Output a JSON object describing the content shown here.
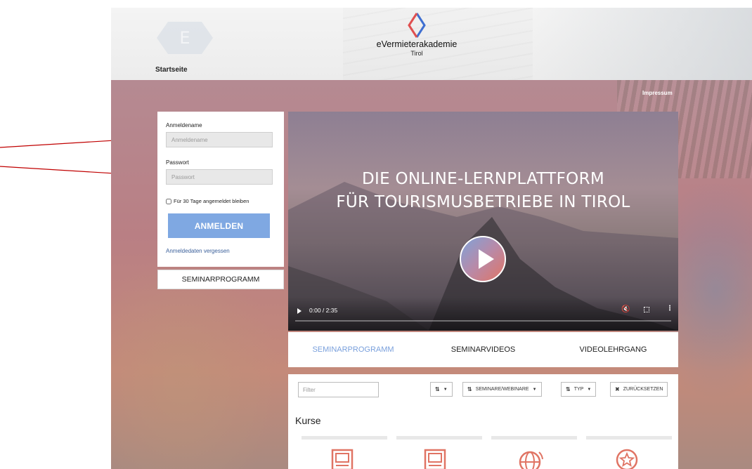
{
  "header": {
    "hex_letter": "E",
    "startseite": "Startseite",
    "logo_title": "eVermieterakademie",
    "logo_sub": "Tirol",
    "impressum": "Impressum"
  },
  "login": {
    "username_label": "Anmeldename",
    "username_placeholder": "Anmeldename",
    "password_label": "Passwort",
    "password_placeholder": "Passwort",
    "remember_label": "Für 30 Tage angemeldet bleiben",
    "login_button": "ANMELDEN",
    "forgot_link": "Anmeldedaten vergessen"
  },
  "seminar_button": "SEMINARPROGRAMM",
  "video": {
    "title_line1": "DIE ONLINE-LERNPLATTFORM",
    "title_line2": "FÜR TOURISMUSBETRIEBE IN TIROL",
    "time": "0:00 / 2:35"
  },
  "tabs": [
    {
      "label": "SEMINARPROGRAMM",
      "active": true
    },
    {
      "label": "SEMINARVIDEOS",
      "active": false
    },
    {
      "label": "VIDEOLEHRGANG",
      "active": false
    }
  ],
  "filters": {
    "filter_placeholder": "Filter",
    "sort_label": "",
    "type_dropdown": "SEMINARE/WEBINARE",
    "typ_dropdown": "TYP",
    "reset": "ZURÜCKSETZEN"
  },
  "section_title": "Kurse",
  "colors": {
    "accent": "#7fa8e2",
    "brand_red": "#e07464",
    "link": "#3a5f9a",
    "annotation_arrow": "#c00000"
  }
}
